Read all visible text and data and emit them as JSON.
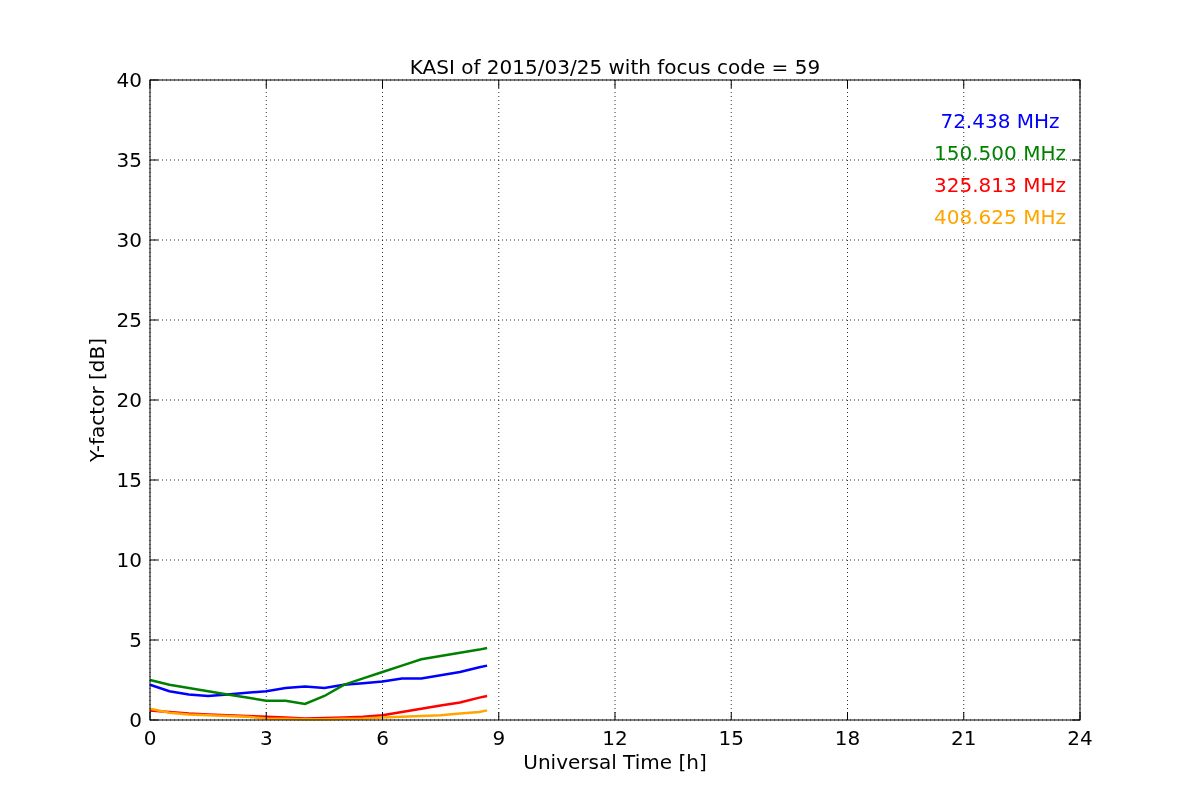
{
  "chart_data": {
    "type": "line",
    "title": "KASI of 2015/03/25 with focus code = 59",
    "xlabel": "Universal Time [h]",
    "ylabel": "Y-factor [dB]",
    "x": [
      0,
      0.5,
      1,
      1.5,
      2,
      2.5,
      3,
      3.5,
      4,
      4.5,
      5,
      5.5,
      6,
      6.5,
      7,
      7.5,
      8,
      8.5,
      8.7
    ],
    "series": [
      {
        "name": "72.438 MHz",
        "color": "#0000ff",
        "values": [
          2.2,
          1.8,
          1.6,
          1.5,
          1.6,
          1.7,
          1.8,
          2.0,
          2.1,
          2.0,
          2.2,
          2.3,
          2.4,
          2.6,
          2.6,
          2.8,
          3.0,
          3.3,
          3.4
        ]
      },
      {
        "name": "150.500 MHz",
        "color": "#008000",
        "values": [
          2.5,
          2.2,
          2.0,
          1.8,
          1.6,
          1.4,
          1.2,
          1.2,
          1.0,
          1.5,
          2.2,
          2.6,
          3.0,
          3.4,
          3.8,
          4.0,
          4.2,
          4.4,
          4.5
        ]
      },
      {
        "name": "325.813 MHz",
        "color": "#ff0000",
        "values": [
          0.6,
          0.5,
          0.4,
          0.35,
          0.3,
          0.25,
          0.2,
          0.15,
          0.1,
          0.12,
          0.15,
          0.2,
          0.3,
          0.5,
          0.7,
          0.9,
          1.1,
          1.4,
          1.5
        ]
      },
      {
        "name": "408.625 MHz",
        "color": "#ffa500",
        "values": [
          0.7,
          0.45,
          0.35,
          0.3,
          0.25,
          0.2,
          0.1,
          0.08,
          0.05,
          0.05,
          0.08,
          0.1,
          0.15,
          0.2,
          0.25,
          0.3,
          0.4,
          0.5,
          0.6
        ]
      }
    ],
    "xlim": [
      0,
      24
    ],
    "ylim": [
      0,
      40
    ],
    "xticks": [
      0,
      3,
      6,
      9,
      12,
      15,
      18,
      21,
      24
    ],
    "yticks": [
      0,
      5,
      10,
      15,
      20,
      25,
      30,
      35,
      40
    ],
    "grid": true
  }
}
